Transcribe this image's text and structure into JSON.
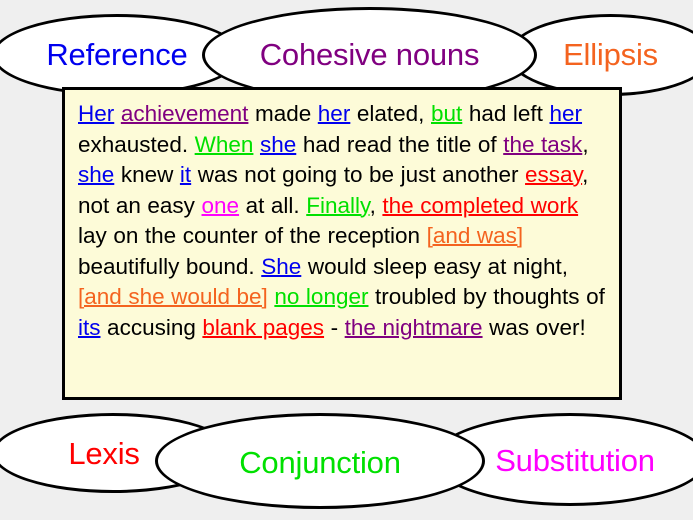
{
  "background_color": "#efefef",
  "legend_colors": {
    "reference": "#0000ee",
    "cohesive_nouns": "#800080",
    "ellipsis": "#f4631f",
    "lexis": "#ff0000",
    "conjunction": "#00e000",
    "substitution": "#ff00ff"
  },
  "top_ovals": [
    {
      "id": "reference",
      "label": "Reference",
      "color": "#0000ee"
    },
    {
      "id": "cohesive-nouns",
      "label": "Cohesive nouns",
      "color": "#800080"
    },
    {
      "id": "ellipsis",
      "label": "Ellipsis",
      "color": "#f4631f"
    }
  ],
  "bottom_ovals": [
    {
      "id": "lexis",
      "label": "Lexis",
      "color": "#ff0000"
    },
    {
      "id": "conjunction",
      "label": "Conjunction",
      "color": "#00e000"
    },
    {
      "id": "substitution",
      "label": "Substitution",
      "color": "#ff00ff"
    }
  ],
  "passage": {
    "background_color": "#fdfbd8",
    "plain_text": "Her achievement made her elated, but had left her exhausted. When she had read the title of the task, she knew it was not going to be just another essay, not an easy one at all. Finally, the completed work lay on the counter of the reception [and was] beautifully bound. She would sleep easy at night, [and she would be] no longer troubled by thoughts of its accusing blank pages - the nightmare was over!",
    "tokens": [
      {
        "t": "Her",
        "c": "#0000ee",
        "u": true
      },
      {
        "t": " "
      },
      {
        "t": "achievement",
        "c": "#800080",
        "u": true
      },
      {
        "t": " made "
      },
      {
        "t": "her",
        "c": "#0000ee",
        "u": true
      },
      {
        "t": " elated, "
      },
      {
        "t": "but",
        "c": "#00e000",
        "u": true
      },
      {
        "t": " had left "
      },
      {
        "t": "her",
        "c": "#0000ee",
        "u": true
      },
      {
        "t": " exhausted. "
      },
      {
        "t": "When",
        "c": "#00e000",
        "u": true
      },
      {
        "t": " "
      },
      {
        "t": "she",
        "c": "#0000ee",
        "u": true
      },
      {
        "t": " had read the title of "
      },
      {
        "t": "the task",
        "c": "#800080",
        "u": true
      },
      {
        "t": ", "
      },
      {
        "t": "she",
        "c": "#0000ee",
        "u": true
      },
      {
        "t": " knew "
      },
      {
        "t": "it",
        "c": "#0000ee",
        "u": true
      },
      {
        "t": " was not going to be just another "
      },
      {
        "t": "essay",
        "c": "#ff0000",
        "u": true
      },
      {
        "t": ", not an easy "
      },
      {
        "t": "one",
        "c": "#ff00ff",
        "u": true
      },
      {
        "t": " at all. "
      },
      {
        "t": "Finally",
        "c": "#00e000",
        "u": true
      },
      {
        "t": ", "
      },
      {
        "t": "the completed work",
        "c": "#ff0000",
        "u": true
      },
      {
        "t": " lay on the counter of the reception "
      },
      {
        "t": "[and was]",
        "c": "#f4631f",
        "u": true
      },
      {
        "t": " beautifully bound. "
      },
      {
        "t": "She",
        "c": "#0000ee",
        "u": true
      },
      {
        "t": " would sleep easy at night, "
      },
      {
        "t": "[and she would be]",
        "c": "#f4631f",
        "u": true
      },
      {
        "t": " "
      },
      {
        "t": "no longer",
        "c": "#00e000",
        "u": true
      },
      {
        "t": " troubled by thoughts of "
      },
      {
        "t": "its",
        "c": "#0000ee",
        "u": true
      },
      {
        "t": " accusing "
      },
      {
        "t": "blank pages",
        "c": "#ff0000",
        "u": true
      },
      {
        "t": " - "
      },
      {
        "t": "the nightmare",
        "c": "#800080",
        "u": true
      },
      {
        "t": " was over!"
      }
    ]
  }
}
